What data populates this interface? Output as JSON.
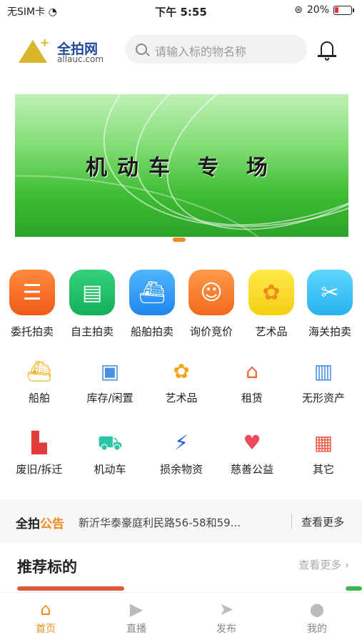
{
  "status": {
    "carrier": "无SIM卡",
    "time": "下午 5:55",
    "battery": "20%"
  },
  "header": {
    "logo_cn": "全拍网",
    "logo_en": "allauc.com",
    "search_placeholder": "请输入标的物名称"
  },
  "banner": {
    "title": "机动车 专 场"
  },
  "main_categories": [
    {
      "label": "委托拍卖",
      "icon": "document-list-icon"
    },
    {
      "label": "自主拍卖",
      "icon": "clipboard-icon"
    },
    {
      "label": "船舶拍卖",
      "icon": "ship-icon"
    },
    {
      "label": "询价竞价",
      "icon": "chat-smile-icon"
    },
    {
      "label": "艺术品",
      "icon": "palette-icon"
    },
    {
      "label": "海关拍卖",
      "icon": "customs-tools-icon"
    }
  ],
  "sub_categories": [
    {
      "label": "船舶",
      "icon": "ship-icon"
    },
    {
      "label": "库存/闲置",
      "icon": "boxes-icon"
    },
    {
      "label": "艺术品",
      "icon": "palette-icon"
    },
    {
      "label": "租赁",
      "icon": "house-icon"
    },
    {
      "label": "无形资产",
      "icon": "building-icon"
    },
    {
      "label": "废旧/拆迁",
      "icon": "factory-icon"
    },
    {
      "label": "机动车",
      "icon": "car-icon"
    },
    {
      "label": "损余物资",
      "icon": "broken-bar-icon"
    },
    {
      "label": "慈善公益",
      "icon": "heart-icon"
    },
    {
      "label": "其它",
      "icon": "grid-icon"
    }
  ],
  "notice": {
    "brand_1": "全拍",
    "brand_2": "公告",
    "text": "新沂华泰豪庭利民路56-58和59...",
    "more": "查看更多"
  },
  "recommend": {
    "title": "推荐标的",
    "more": "查看更多 ›"
  },
  "tabs": [
    {
      "label": "首页",
      "icon": "home-icon"
    },
    {
      "label": "直播",
      "icon": "video-icon"
    },
    {
      "label": "发布",
      "icon": "send-icon"
    },
    {
      "label": "我的",
      "icon": "user-icon"
    }
  ],
  "colors": {
    "accent": "#f08c1e",
    "brand_blue": "#1f4a9a"
  }
}
